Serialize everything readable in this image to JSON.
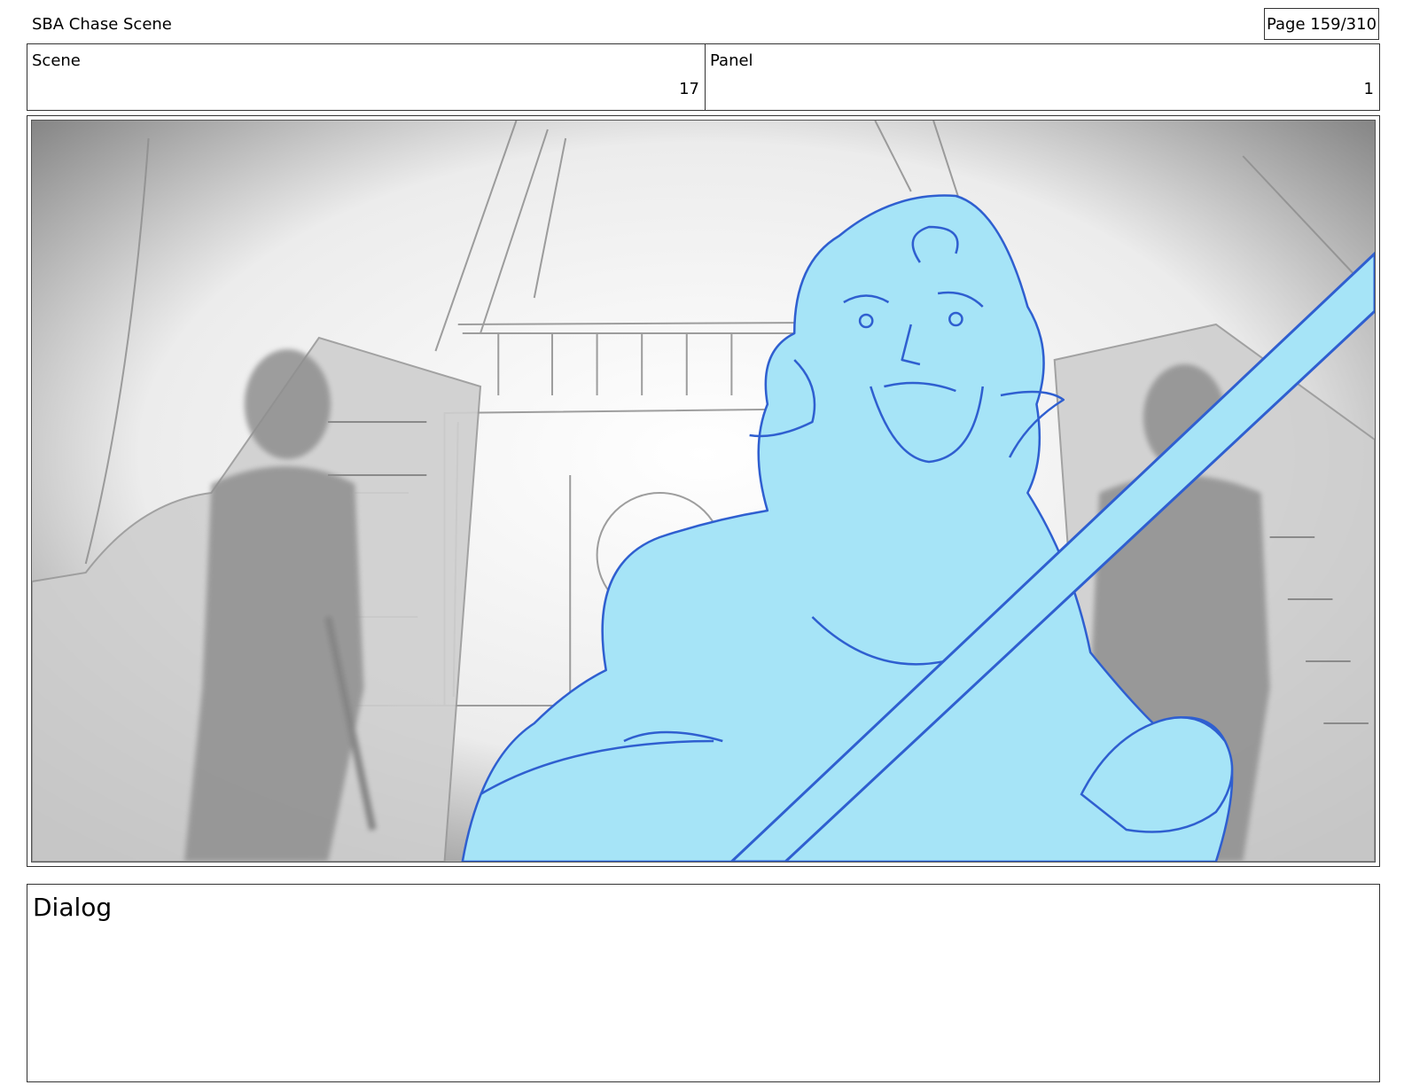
{
  "header": {
    "project_title": "SBA Chase Scene",
    "page_label": "Page 159/310"
  },
  "info": {
    "scene_label": "Scene",
    "scene_value": "17",
    "panel_label": "Panel",
    "panel_value": "1"
  },
  "storyboard_frame": {
    "description_icon": "storyboard-sketch-ship-deck"
  },
  "dialog": {
    "label": "Dialog"
  },
  "colors": {
    "sketch_fill": "#a6e4f7",
    "sketch_line": "#2f5fd0",
    "background_sketch": "#9a9a9a"
  }
}
